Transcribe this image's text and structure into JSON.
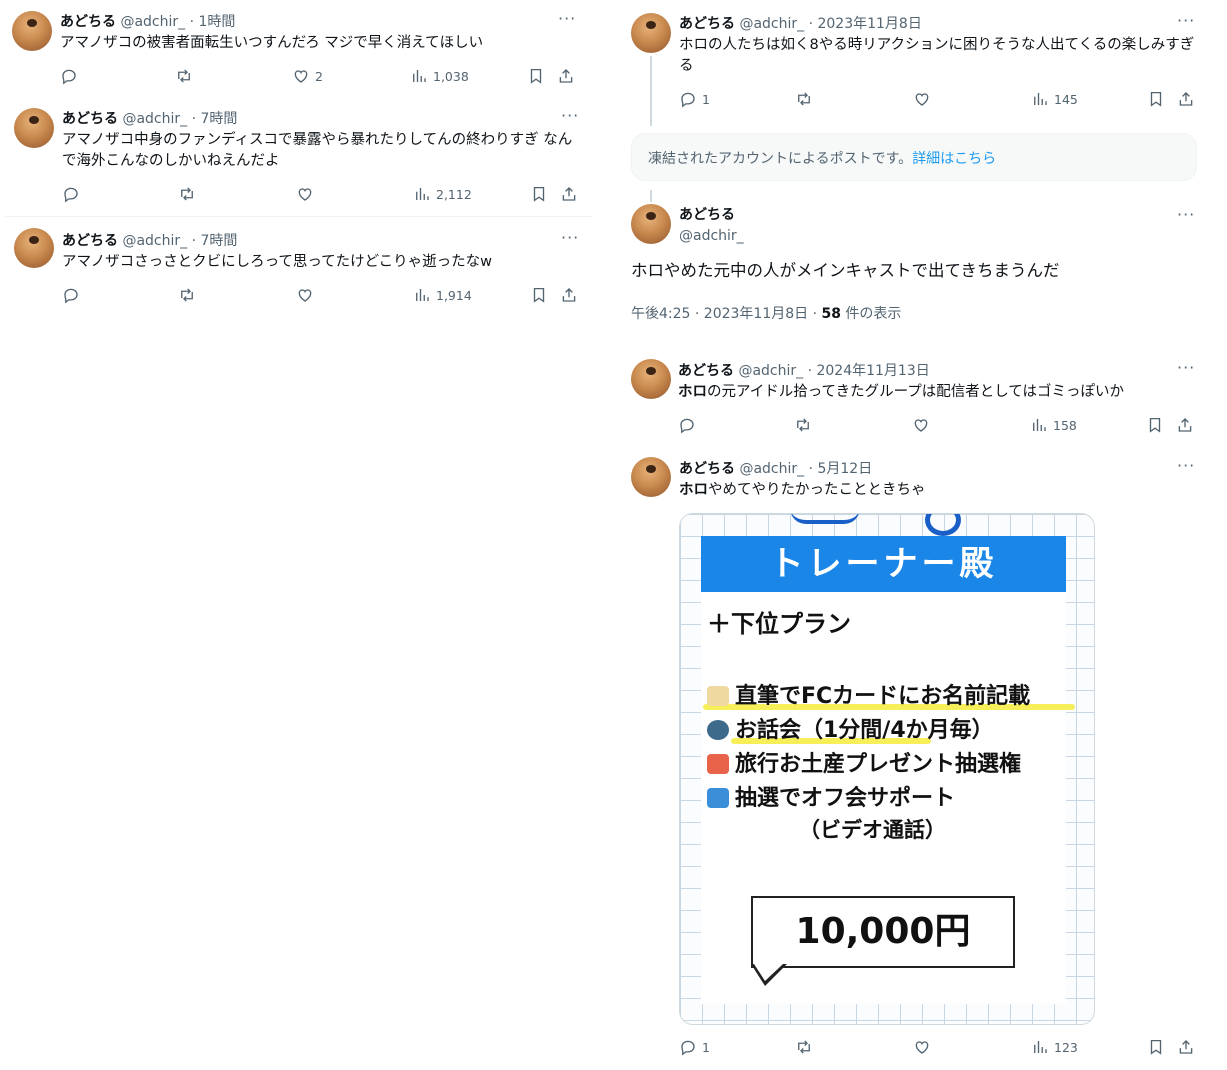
{
  "user": {
    "name": "あどちる",
    "handle": "@adchir_"
  },
  "left_tweets": [
    {
      "time": "· 1時間",
      "text": "アマノザコの被害者面転生いつすんだろ マジで早く消えてほしい",
      "reply": "",
      "retweet": "",
      "like": "2",
      "views": "1,038"
    },
    {
      "time": "· 7時間",
      "text": "アマノザコ中身のファンディスコで暴露やら暴れたりしてんの終わりすぎ なんで海外こんなのしかいねえんだよ",
      "reply": "",
      "retweet": "",
      "like": "",
      "views": "2,112"
    },
    {
      "time": "· 7時間",
      "text": "アマノザコさっさとクビにしろって思ってたけどこりゃ逝ったなw",
      "reply": "",
      "retweet": "",
      "like": "",
      "views": "1,914"
    }
  ],
  "right": {
    "tweet1": {
      "time": "· 2023年11月8日",
      "text": "ホロの人たちは如く8やる時リアクションに困りそうな人出てくるの楽しみすぎる",
      "reply": "1",
      "retweet": "",
      "like": "",
      "views": "145"
    },
    "notice": {
      "text": "凍結されたアカウントによるポストです。",
      "link": "詳細はこちら"
    },
    "main": {
      "text": "ホロやめた元中の人がメインキャストで出てきちまうんだ",
      "timestamp": "午後4:25 · 2023年11月8日 · ",
      "views_count": "58",
      "views_label": " 件の表示"
    },
    "tweet3": {
      "time": "· 2024年11月13日",
      "bold": "ホロ",
      "text": "の元アイドル拾ってきたグループは配信者としてはゴミっぽいか",
      "reply": "",
      "retweet": "",
      "like": "",
      "views": "158"
    },
    "tweet4": {
      "time": "· 5月12日",
      "bold": "ホロ",
      "text": "やめてやりたかったことときちゃ",
      "reply": "1",
      "retweet": "",
      "like": "",
      "views": "123"
    },
    "image": {
      "title": "トレーナー殿",
      "plan": "＋下位プラン",
      "items": [
        "直筆でFCカードにお名前記載",
        "お話会（1分間/4か月毎）",
        "旅行お土産プレゼント抽選権",
        "抽選でオフ会サポート"
      ],
      "items_sub": "（ビデオ通話）",
      "price": "10,000円"
    }
  },
  "more_label": "···"
}
